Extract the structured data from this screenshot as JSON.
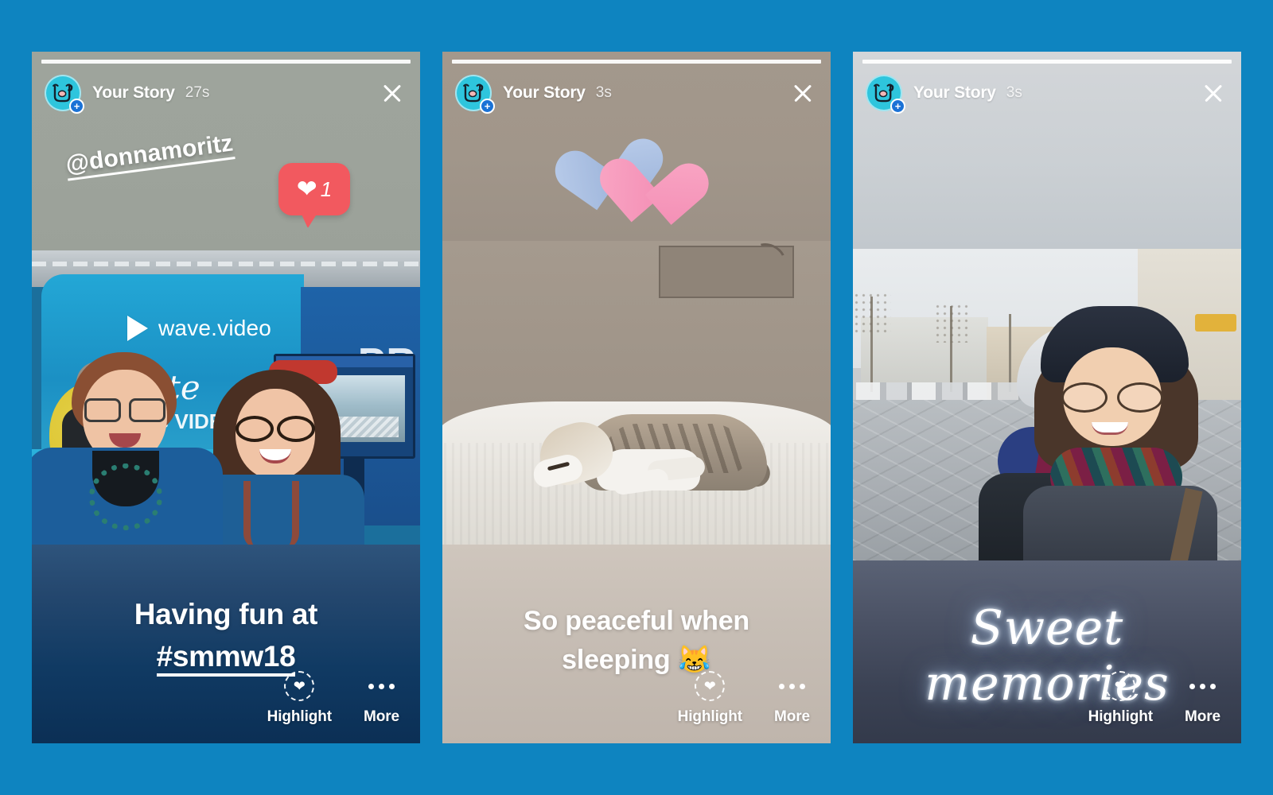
{
  "background_color": "#0e84c0",
  "stories": [
    {
      "id": "story-1",
      "user": "Your Story",
      "time": "27s",
      "avatar_icon": "cat-doodle-avatar",
      "add_badge": "+",
      "close_icon": "close-icon",
      "progress_segments": 1,
      "mention_sticker": "@donnamoritz",
      "like_badge": {
        "icon": "heart-icon",
        "count": "1",
        "color": "#f2595f"
      },
      "caption_line1": "Having fun at",
      "caption_line2": "#smmw18",
      "photo_alt": "Two women smiling in front of a wave.video conference booth",
      "photo_texts": {
        "brand": "wave.video",
        "script": "te",
        "sub": "G VIDE",
        "right": "PR"
      },
      "actions": [
        {
          "label": "Highlight",
          "icon": "highlight-heart-icon"
        },
        {
          "label": "More",
          "icon": "more-dots-icon"
        }
      ]
    },
    {
      "id": "story-2",
      "user": "Your Story",
      "time": "3s",
      "avatar_icon": "cat-doodle-avatar",
      "add_badge": "+",
      "close_icon": "close-icon",
      "progress_segments": 1,
      "sticker": "two-hearts-emoji",
      "sticker_colors": {
        "blue": "#a9c0e2",
        "pink": "#f79ebd"
      },
      "caption_line1": "So peaceful when",
      "caption_line2": "sleeping 😹",
      "photo_alt": "Tabby cat sleeping on a white bed",
      "actions": [
        {
          "label": "Highlight",
          "icon": "highlight-heart-icon"
        },
        {
          "label": "More",
          "icon": "more-dots-icon"
        }
      ]
    },
    {
      "id": "story-3",
      "user": "Your Story",
      "time": "3s",
      "avatar_icon": "cat-doodle-avatar",
      "add_badge": "+",
      "close_icon": "close-icon",
      "progress_segments": 1,
      "caption_line1": "Sweet memories",
      "photo_alt": "Two women in winter clothes taking a selfie in a city square",
      "actions": [
        {
          "label": "Highlight",
          "icon": "highlight-heart-icon"
        },
        {
          "label": "More",
          "icon": "more-dots-icon"
        }
      ]
    }
  ]
}
